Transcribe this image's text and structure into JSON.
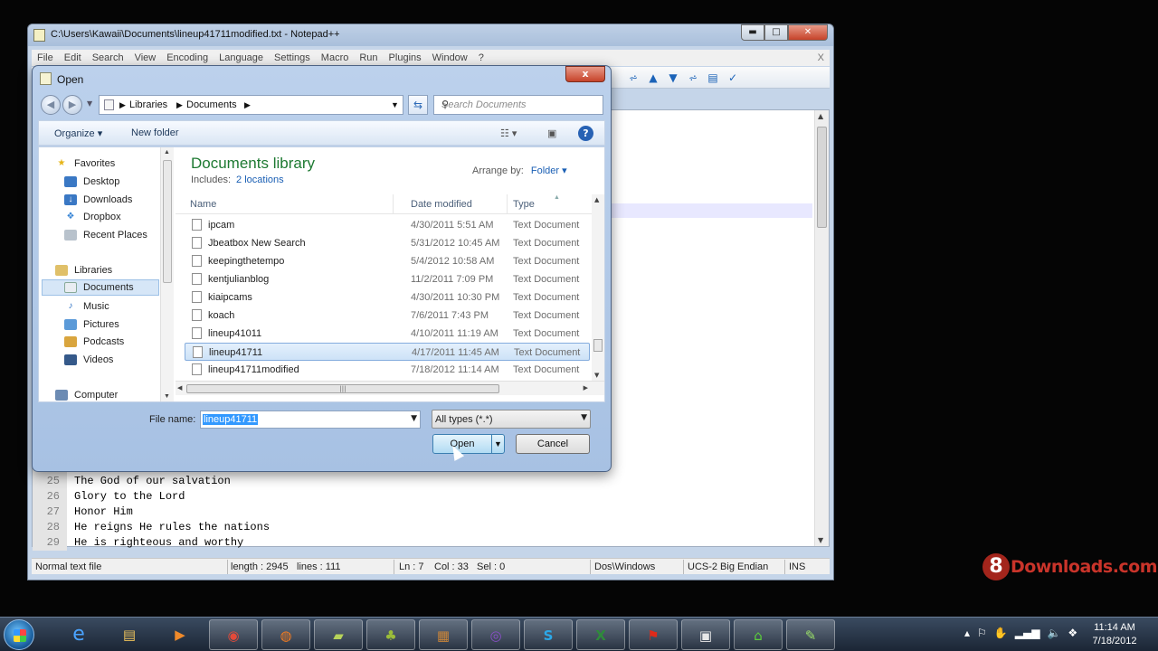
{
  "npp": {
    "title": "C:\\Users\\Kawaii\\Documents\\lineup41711modified.txt - Notepad++",
    "menu": [
      "File",
      "Edit",
      "Search",
      "View",
      "Encoding",
      "Language",
      "Settings",
      "Macro",
      "Run",
      "Plugins",
      "Window",
      "?"
    ],
    "menu_close": "X",
    "code_lines": [
      {
        "num": "25",
        "text": "The God of our salvation"
      },
      {
        "num": "26",
        "text": "Glory to the Lord"
      },
      {
        "num": "27",
        "text": "Honor Him"
      },
      {
        "num": "28",
        "text": "He reigns He rules the nations"
      },
      {
        "num": "29",
        "text": "He is righteous and worthy"
      }
    ],
    "status": {
      "type": "Normal text file",
      "length": "length : 2945",
      "lines": "lines : 111",
      "ln": "Ln : 7",
      "col": "Col : 33",
      "sel": "Sel : 0",
      "eol": "Dos\\Windows",
      "encoding": "UCS-2 Big Endian",
      "mode": "INS"
    }
  },
  "dialog": {
    "title": "Open",
    "close": "x",
    "breadcrumb": [
      "Libraries",
      "Documents"
    ],
    "search_placeholder": "Search Documents",
    "organize": "Organize",
    "new_folder": "New folder",
    "nav": {
      "favorites": "Favorites",
      "desktop": "Desktop",
      "downloads": "Downloads",
      "dropbox": "Dropbox",
      "recent": "Recent Places",
      "libraries": "Libraries",
      "documents": "Documents",
      "music": "Music",
      "pictures": "Pictures",
      "podcasts": "Podcasts",
      "videos": "Videos",
      "computer": "Computer"
    },
    "library_title": "Documents library",
    "includes_label": "Includes:",
    "includes_link": "2 locations",
    "arrange_label": "Arrange by:",
    "arrange_value": "Folder",
    "columns": {
      "name": "Name",
      "date": "Date modified",
      "type": "Type"
    },
    "files": [
      {
        "name": "ipcam",
        "date": "4/30/2011 5:51 AM",
        "type": "Text Document"
      },
      {
        "name": "Jbeatbox New Search",
        "date": "5/31/2012 10:45 AM",
        "type": "Text Document"
      },
      {
        "name": "keepingthetempo",
        "date": "5/4/2012 10:58 AM",
        "type": "Text Document"
      },
      {
        "name": "kentjulianblog",
        "date": "11/2/2011 7:09 PM",
        "type": "Text Document"
      },
      {
        "name": "kiaipcams",
        "date": "4/30/2011 10:30 PM",
        "type": "Text Document"
      },
      {
        "name": "koach",
        "date": "7/6/2011 7:43 PM",
        "type": "Text Document"
      },
      {
        "name": "lineup41011",
        "date": "4/10/2011 11:19 AM",
        "type": "Text Document"
      },
      {
        "name": "lineup41711",
        "date": "4/17/2011 11:45 AM",
        "type": "Text Document"
      },
      {
        "name": "lineup41711modified",
        "date": "7/18/2012 11:14 AM",
        "type": "Text Document"
      }
    ],
    "selected_index": 7,
    "filename_label": "File name:",
    "filename_value": "lineup41711",
    "filetype_value": "All types (*.*)",
    "open_button": "Open",
    "cancel_button": "Cancel"
  },
  "watermark": {
    "digit": "8",
    "text": "Downloads.com"
  },
  "taskbar": {
    "apps": [
      "internet-explorer",
      "explorer",
      "media-player",
      "chrome",
      "firefox",
      "notes",
      "launcher",
      "winrar",
      "app",
      "skype",
      "excel",
      "acrobat",
      "window",
      "home",
      "notepad-plus-plus"
    ],
    "time": "11:14 AM",
    "date": "7/18/2012"
  },
  "colors": {
    "accent": "#1e7a32",
    "selection": "#3399ff",
    "link": "#1a5fb4"
  }
}
